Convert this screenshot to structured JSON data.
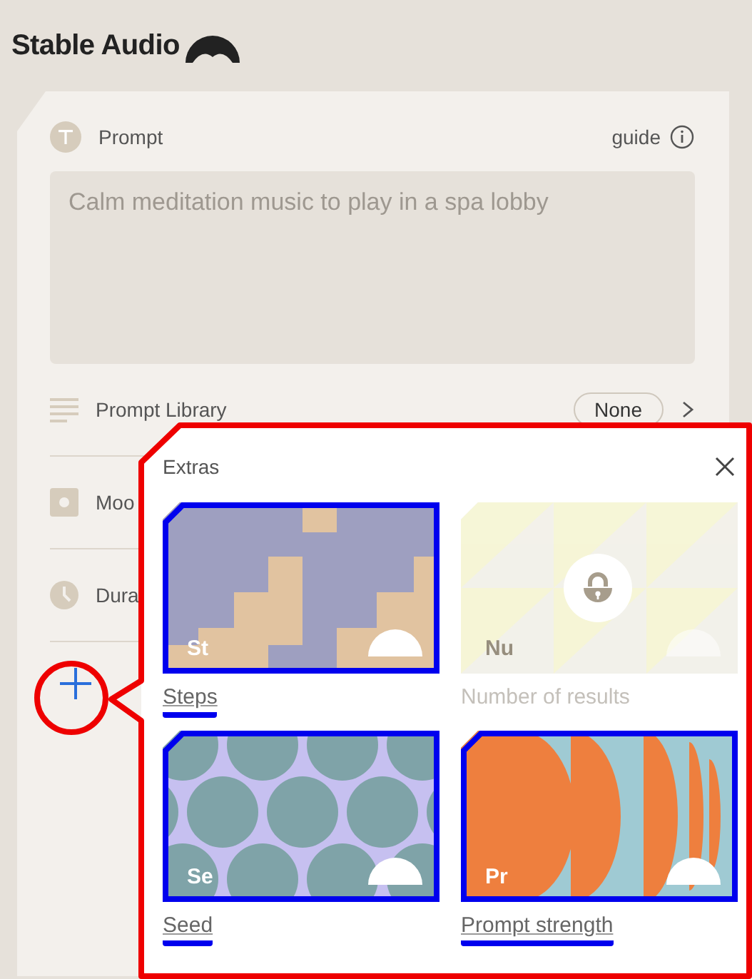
{
  "brand": {
    "name": "Stable Audio"
  },
  "prompt": {
    "label": "Prompt",
    "guide": "guide",
    "placeholder": "Calm meditation music to play in a spa lobby"
  },
  "settings": [
    {
      "kind": "library",
      "label": "Prompt Library",
      "value": "None"
    },
    {
      "kind": "model",
      "label": "Moo"
    },
    {
      "kind": "duration",
      "label": "Dura"
    }
  ],
  "add_button": {
    "highlighted": true
  },
  "extras": {
    "title": "Extras",
    "highlighted": true,
    "items": [
      {
        "kind": "steps",
        "abbr": "St",
        "label": "Steps",
        "disabled": false,
        "highlighted": true
      },
      {
        "kind": "triangles",
        "abbr": "Nu",
        "label": "Number of results",
        "disabled": true,
        "highlighted": false
      },
      {
        "kind": "circles",
        "abbr": "Se",
        "label": "Seed",
        "disabled": false,
        "highlighted": true
      },
      {
        "kind": "arcs",
        "abbr": "Pr",
        "label": "Prompt strength",
        "disabled": false,
        "highlighted": true
      }
    ]
  }
}
